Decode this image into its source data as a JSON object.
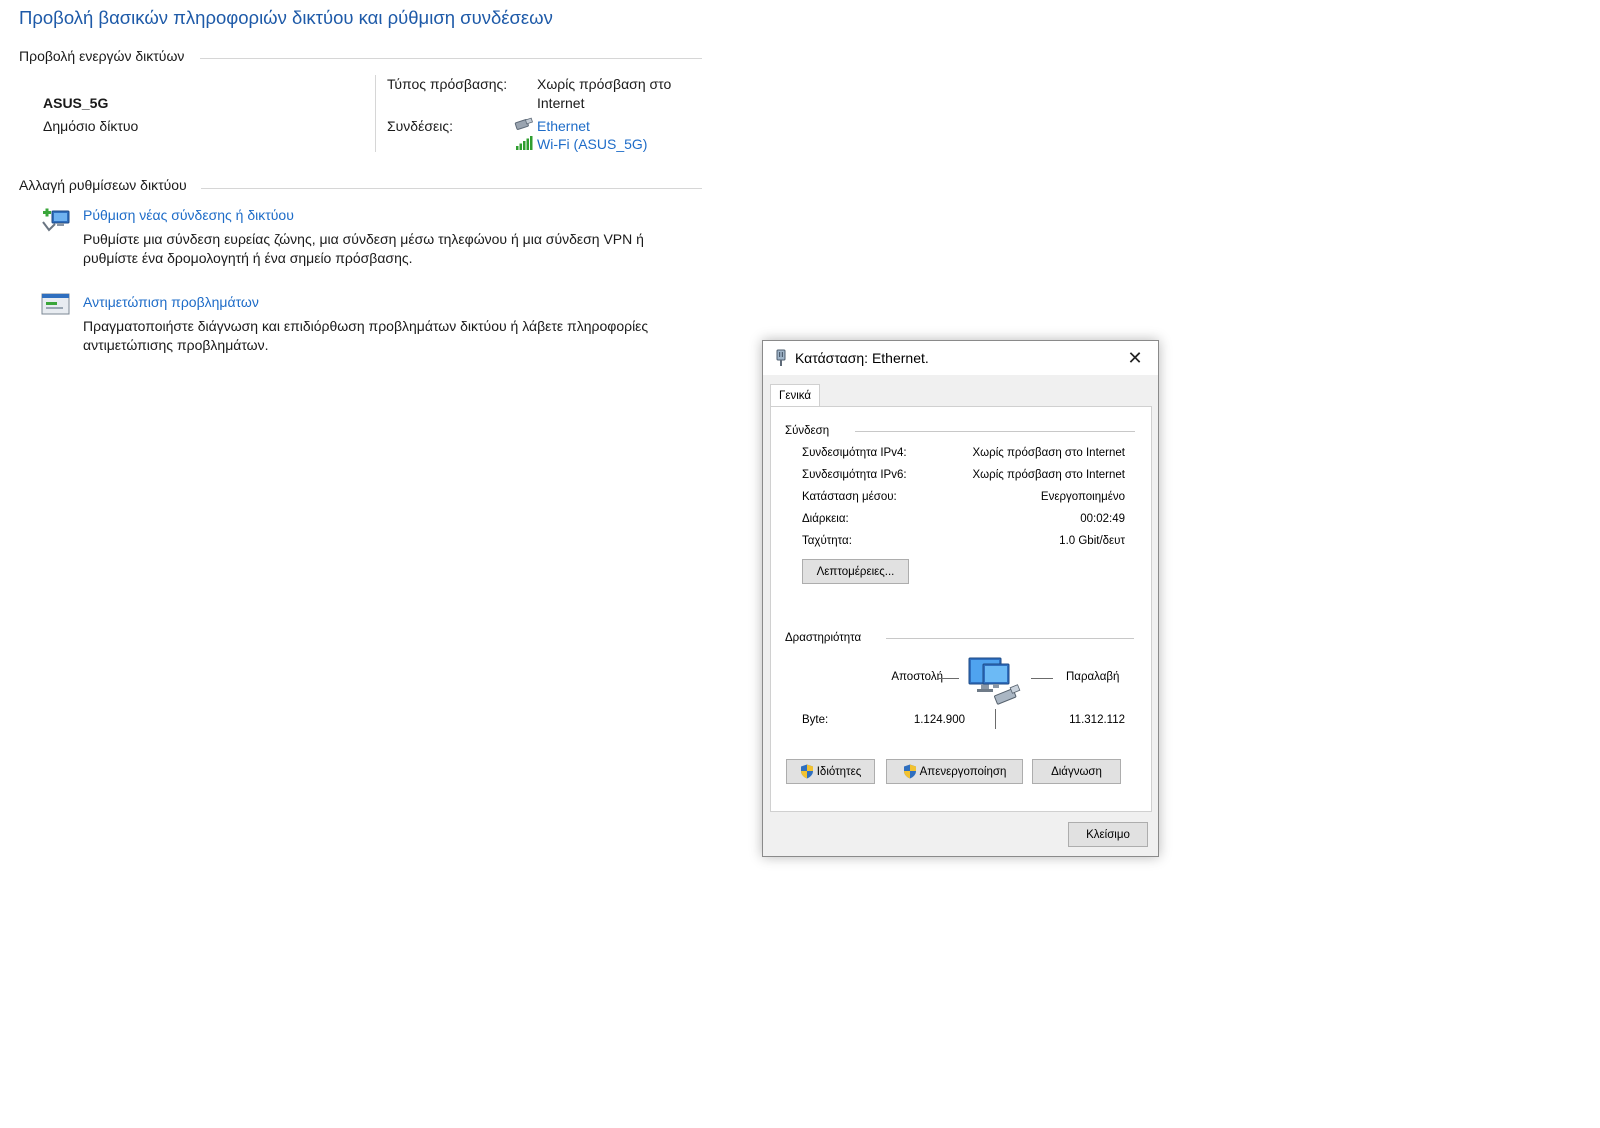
{
  "page": {
    "title": "Προβολή βασικών πληροφοριών δικτύου και ρύθμιση συνδέσεων",
    "active_networks_label": "Προβολή ενεργών δικτύων",
    "network": {
      "name": "ASUS_5G",
      "type": "Δημόσιο δίκτυο",
      "access_type_label": "Τύπος πρόσβασης:",
      "access_type_value_line1": "Χωρίς πρόσβαση στο",
      "access_type_value_line2": "Internet",
      "connections_label": "Συνδέσεις:",
      "connections": [
        {
          "label": "Ethernet",
          "icon": "ethernet-icon"
        },
        {
          "label": "Wi-Fi (ASUS_5G)",
          "icon": "wifi-signal-icon"
        }
      ]
    },
    "change_settings_label": "Αλλαγή ρυθμίσεων δικτύου",
    "tasks": [
      {
        "link": "Ρύθμιση νέας σύνδεσης ή δικτύου",
        "desc_line1": "Ρυθμίστε μια σύνδεση ευρείας ζώνης, μια σύνδεση μέσω τηλεφώνου ή μια σύνδεση VPN ή",
        "desc_line2": "ρυθμίστε ένα δρομολογητή ή ένα σημείο πρόσβασης.",
        "icon": "new-connection-icon"
      },
      {
        "link": "Αντιμετώπιση προβλημάτων",
        "desc_line1": "Πραγματοποιήστε διάγνωση και επιδιόρθωση προβλημάτων δικτύου ή λάβετε πληροφορίες",
        "desc_line2": "αντιμετώπισης προβλημάτων.",
        "icon": "troubleshoot-icon"
      }
    ]
  },
  "dialog": {
    "title": "Κατάσταση: Ethernet.",
    "tab": "Γενικά",
    "connection_group": "Σύνδεση",
    "rows": [
      {
        "label": "Συνδεσιμότητα IPv4:",
        "value": "Χωρίς πρόσβαση στο Internet"
      },
      {
        "label": "Συνδεσιμότητα IPv6:",
        "value": "Χωρίς πρόσβαση στο Internet"
      },
      {
        "label": "Κατάσταση μέσου:",
        "value": "Ενεργοποιημένο"
      },
      {
        "label": "Διάρκεια:",
        "value": "00:02:49"
      },
      {
        "label": "Ταχύτητα:",
        "value": "1.0 Gbit/δευτ"
      }
    ],
    "details_button": "Λεπτομέρειες...",
    "activity_group": "Δραστηριότητα",
    "sent_label": "Αποστολή",
    "received_label": "Παραλαβή",
    "bytes_label": "Byte:",
    "bytes_sent": "1.124.900",
    "bytes_received": "11.312.112",
    "properties_button": "Ιδιότητες",
    "disable_button": "Απενεργοποίηση",
    "diagnose_button": "Διάγνωση",
    "close_button": "Κλείσιμο"
  },
  "colors": {
    "title_blue": "#1e5aa8",
    "link_blue": "#1e6cc8",
    "dialog_bg": "#f0f0f0",
    "button_bg": "#e1e1e1"
  }
}
